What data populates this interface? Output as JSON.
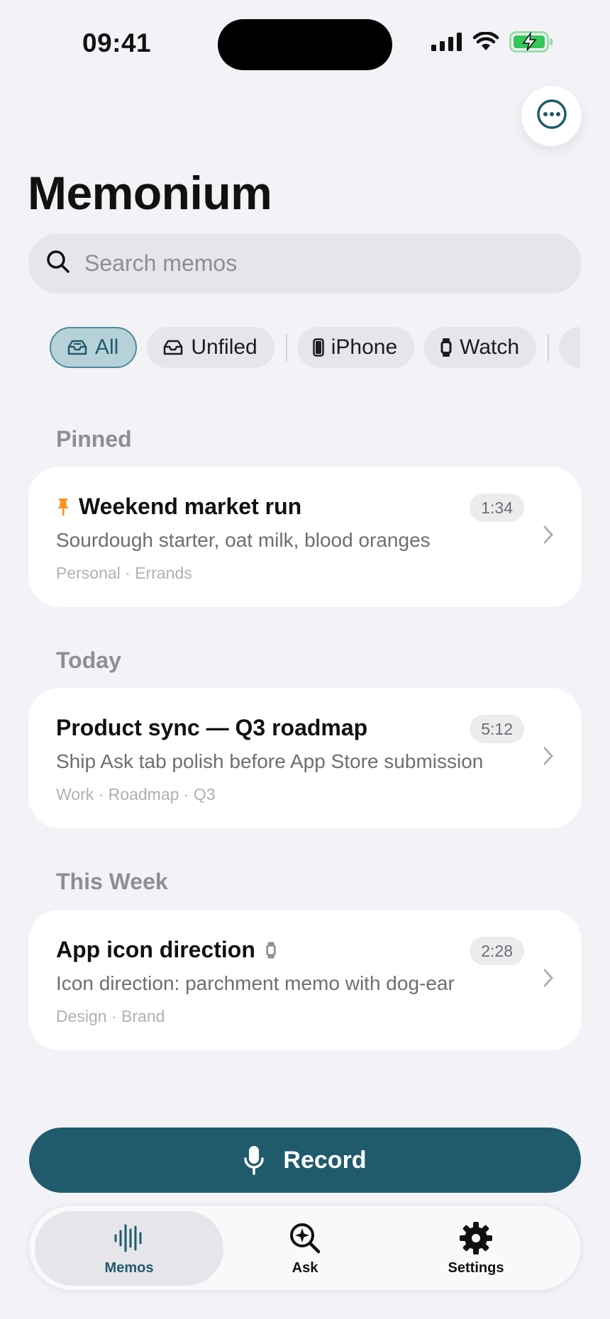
{
  "status_bar": {
    "time": "09:41"
  },
  "header": {
    "title": "Memonium",
    "more_icon": "ellipsis-circle-icon"
  },
  "search": {
    "placeholder": "Search memos",
    "value": ""
  },
  "filters": [
    {
      "label": "All",
      "icon": "tray-icon",
      "active": true
    },
    {
      "label": "Unfiled",
      "icon": "tray-empty-icon",
      "active": false
    },
    {
      "label": "iPhone",
      "icon": "iphone-icon",
      "active": false
    },
    {
      "label": "Watch",
      "icon": "watch-icon",
      "active": false
    }
  ],
  "sections": [
    {
      "header": "Pinned",
      "memos": [
        {
          "title": "Weekend market run",
          "summary": "Sourdough starter, oat milk, blood oranges",
          "tags": "Personal · Errands",
          "duration": "1:34",
          "pinned": true
        }
      ]
    },
    {
      "header": "Today",
      "memos": [
        {
          "title": "Product sync — Q3 roadmap",
          "summary": "Ship Ask tab polish before App Store submission",
          "tags": "Work · Roadmap · Q3",
          "duration": "5:12"
        }
      ]
    },
    {
      "header": "This Week",
      "memos": [
        {
          "title": "App icon direction",
          "summary": "Icon direction: parchment memo with dog-ear",
          "tags": "Design · Brand",
          "duration": "2:28",
          "source_icon": "watch-icon"
        }
      ]
    }
  ],
  "record": {
    "label": "Record",
    "icon": "microphone-icon"
  },
  "tabs": [
    {
      "label": "Memos",
      "icon": "waveform-icon",
      "active": true
    },
    {
      "label": "Ask",
      "icon": "magnifier-sparkle-icon",
      "active": false
    },
    {
      "label": "Settings",
      "icon": "gear-icon",
      "active": false
    }
  ],
  "colors": {
    "background": "#f2f2f7",
    "accent": "#205a6d",
    "active_chip_bg": "#b7d1d8",
    "pin": "#f7931e",
    "battery": "#34c759"
  }
}
